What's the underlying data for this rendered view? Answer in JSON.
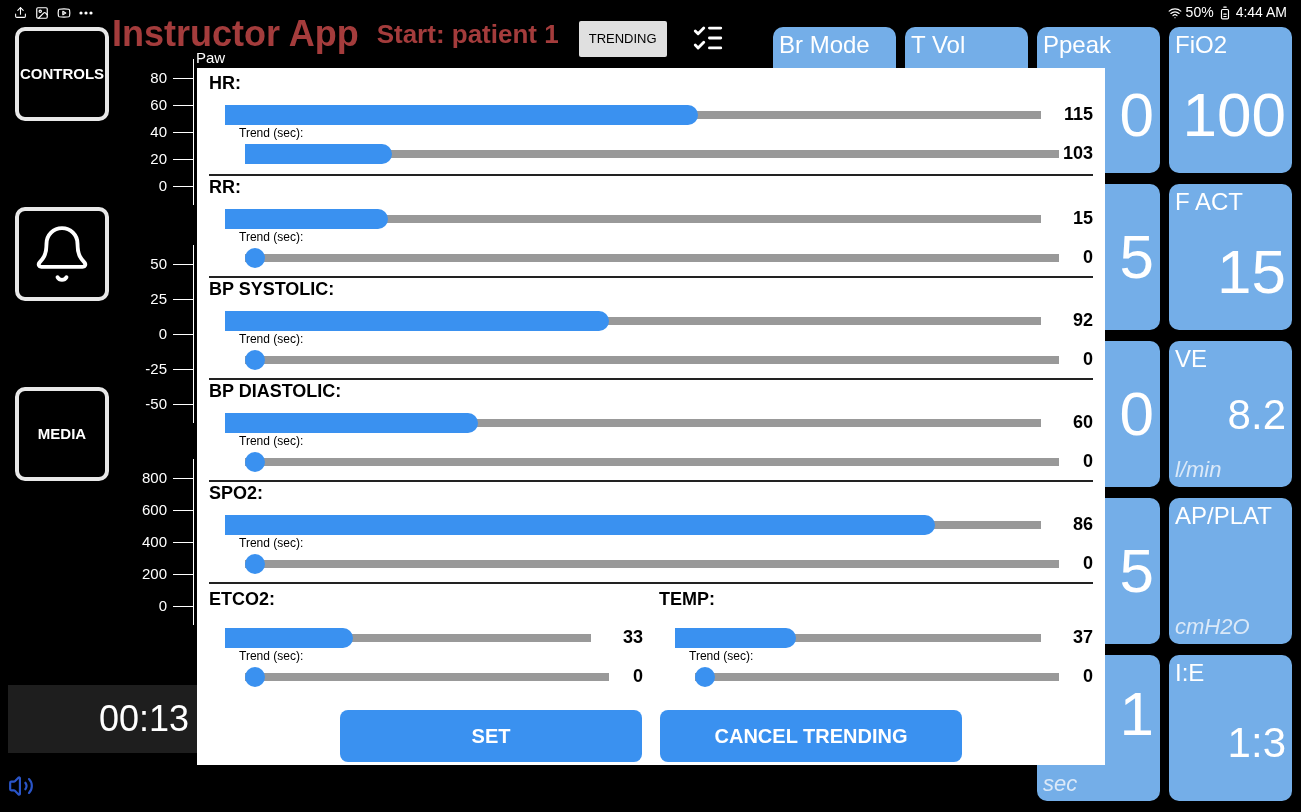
{
  "status_bar": {
    "battery": "50%",
    "time": "4:44 AM"
  },
  "header": {
    "title": "Instructor App",
    "subtitle": "Start: patient 1",
    "trending_button": "TRENDING"
  },
  "side_buttons": [
    {
      "kind": "text",
      "label": "CONTROLS"
    },
    {
      "kind": "bell"
    },
    {
      "kind": "text",
      "label": "MEDIA"
    }
  ],
  "axes": [
    {
      "label": "Paw",
      "ticks": [
        "80",
        "60",
        "40",
        "20",
        "0"
      ]
    },
    {
      "ticks": [
        "50",
        "25",
        "0",
        "-25",
        "-50"
      ]
    },
    {
      "ticks": [
        "800",
        "600",
        "400",
        "200",
        "0"
      ]
    }
  ],
  "timer": "00:13",
  "tile_columns": [
    [
      {
        "title": "Br Mode"
      }
    ],
    [
      {
        "title": "T Vol"
      }
    ],
    [
      {
        "title": "Ppeak",
        "value": "0"
      },
      {
        "value": "5"
      },
      {
        "value": "0"
      },
      {
        "value": "5"
      },
      {
        "value": "1",
        "unit": "sec"
      }
    ],
    [
      {
        "title": "FiO2",
        "value": "100"
      },
      {
        "title": "F ACT",
        "value": "15"
      },
      {
        "title": "VE",
        "value": "8.2",
        "unit": "l/min"
      },
      {
        "title": "AP/PLAT",
        "unit": "cmH2O"
      },
      {
        "title": "I:E",
        "value": "1:3"
      }
    ]
  ],
  "dialog": {
    "params": [
      {
        "label": "HR:",
        "level": 0.58,
        "value": "115",
        "trend": {
          "label": "Trend (sec):",
          "level": 0.18,
          "value": "103"
        }
      },
      {
        "label": "RR:",
        "level": 0.2,
        "value": "15",
        "trend": {
          "label": "Trend (sec):",
          "level": 0,
          "value": "0"
        }
      },
      {
        "label": "BP SYSTOLIC:",
        "level": 0.47,
        "value": "92",
        "trend": {
          "label": "Trend (sec):",
          "level": 0,
          "value": "0"
        }
      },
      {
        "label": "BP DIASTOLIC:",
        "level": 0.31,
        "value": "60",
        "trend": {
          "label": "Trend (sec):",
          "level": 0,
          "value": "0"
        }
      },
      {
        "label": "SPO2:",
        "level": 0.87,
        "value": "86",
        "trend": {
          "label": "Trend (sec):",
          "level": 0,
          "value": "0"
        }
      }
    ],
    "pair": [
      {
        "label": "ETCO2:",
        "level": 0.35,
        "value": "33",
        "trend": {
          "label": "Trend (sec):",
          "level": 0,
          "value": "0"
        }
      },
      {
        "label": "TEMP:",
        "level": 0.33,
        "value": "37",
        "trend": {
          "label": "Trend (sec):",
          "level": 0,
          "value": "0"
        }
      }
    ],
    "buttons": [
      "SET",
      "CANCEL TRENDING"
    ]
  }
}
